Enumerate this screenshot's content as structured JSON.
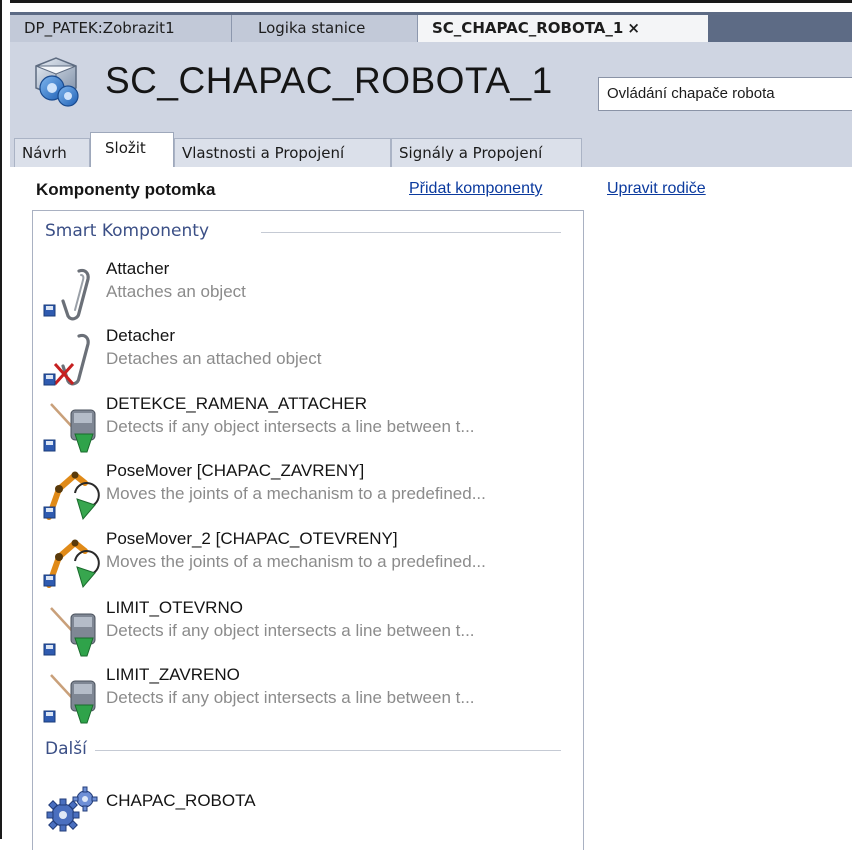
{
  "doc_tabs": [
    {
      "label": "DP_PATEK:Zobrazit1"
    },
    {
      "label": "Logika stanice"
    },
    {
      "label": "SC_CHAPAC_ROBOTA_1"
    }
  ],
  "close_glyph": "×",
  "header": {
    "title": "SC_CHAPAC_ROBOTA_1",
    "description": "Ovládání chapače robota"
  },
  "sub_tabs": [
    {
      "label": "Návrh"
    },
    {
      "label": "Složit"
    },
    {
      "label": "Vlastnosti a Propojení"
    },
    {
      "label": "Signály a Propojení"
    }
  ],
  "content": {
    "section_title": "Komponenty potomka",
    "add_link": "Přidat komponenty",
    "edit_parent_link": "Upravit rodiče"
  },
  "groups": {
    "smart": {
      "label": "Smart Komponenty",
      "items": [
        {
          "name": "Attacher",
          "desc": "Attaches an object",
          "icon": "paperclip-icon"
        },
        {
          "name": "Detacher",
          "desc": "Detaches an attached object",
          "icon": "paperclip-remove-icon"
        },
        {
          "name": "DETEKCE_RAMENA_ATTACHER",
          "desc": "Detects if any object intersects a line between t...",
          "icon": "line-sensor-icon"
        },
        {
          "name": "PoseMover [CHAPAC_ZAVRENY]",
          "desc": "Moves the joints of a mechanism to a predefined...",
          "icon": "pose-mover-icon"
        },
        {
          "name": "PoseMover_2 [CHAPAC_OTEVRENY]",
          "desc": "Moves the joints of a mechanism to a predefined...",
          "icon": "pose-mover-icon"
        },
        {
          "name": "LIMIT_OTEVRNO",
          "desc": "Detects if any object intersects a line between t...",
          "icon": "line-sensor-icon"
        },
        {
          "name": "LIMIT_ZAVRENO",
          "desc": "Detects if any object intersects a line between t...",
          "icon": "line-sensor-icon"
        }
      ]
    },
    "other": {
      "label": "Další",
      "items": [
        {
          "name": "CHAPAC_ROBOTA",
          "icon": "gears-icon"
        }
      ]
    }
  }
}
